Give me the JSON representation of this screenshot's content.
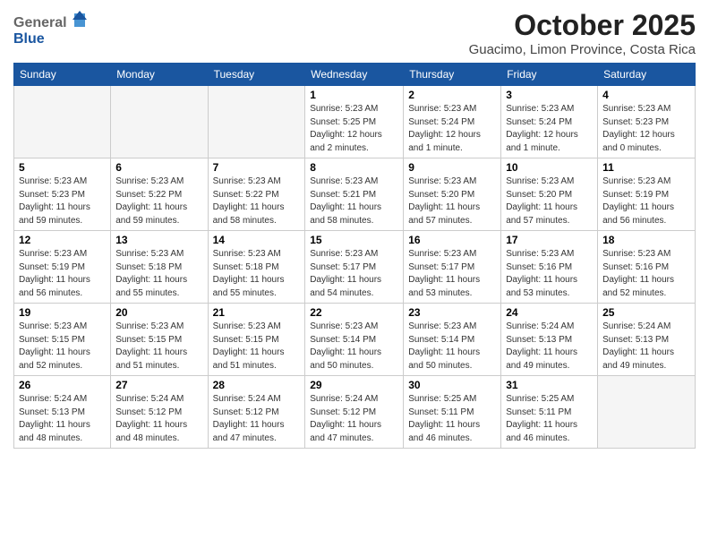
{
  "header": {
    "logo_general": "General",
    "logo_blue": "Blue",
    "month_title": "October 2025",
    "location": "Guacimo, Limon Province, Costa Rica"
  },
  "weekdays": [
    "Sunday",
    "Monday",
    "Tuesday",
    "Wednesday",
    "Thursday",
    "Friday",
    "Saturday"
  ],
  "weeks": [
    [
      {
        "day": "",
        "info": ""
      },
      {
        "day": "",
        "info": ""
      },
      {
        "day": "",
        "info": ""
      },
      {
        "day": "1",
        "info": "Sunrise: 5:23 AM\nSunset: 5:25 PM\nDaylight: 12 hours\nand 2 minutes."
      },
      {
        "day": "2",
        "info": "Sunrise: 5:23 AM\nSunset: 5:24 PM\nDaylight: 12 hours\nand 1 minute."
      },
      {
        "day": "3",
        "info": "Sunrise: 5:23 AM\nSunset: 5:24 PM\nDaylight: 12 hours\nand 1 minute."
      },
      {
        "day": "4",
        "info": "Sunrise: 5:23 AM\nSunset: 5:23 PM\nDaylight: 12 hours\nand 0 minutes."
      }
    ],
    [
      {
        "day": "5",
        "info": "Sunrise: 5:23 AM\nSunset: 5:23 PM\nDaylight: 11 hours\nand 59 minutes."
      },
      {
        "day": "6",
        "info": "Sunrise: 5:23 AM\nSunset: 5:22 PM\nDaylight: 11 hours\nand 59 minutes."
      },
      {
        "day": "7",
        "info": "Sunrise: 5:23 AM\nSunset: 5:22 PM\nDaylight: 11 hours\nand 58 minutes."
      },
      {
        "day": "8",
        "info": "Sunrise: 5:23 AM\nSunset: 5:21 PM\nDaylight: 11 hours\nand 58 minutes."
      },
      {
        "day": "9",
        "info": "Sunrise: 5:23 AM\nSunset: 5:20 PM\nDaylight: 11 hours\nand 57 minutes."
      },
      {
        "day": "10",
        "info": "Sunrise: 5:23 AM\nSunset: 5:20 PM\nDaylight: 11 hours\nand 57 minutes."
      },
      {
        "day": "11",
        "info": "Sunrise: 5:23 AM\nSunset: 5:19 PM\nDaylight: 11 hours\nand 56 minutes."
      }
    ],
    [
      {
        "day": "12",
        "info": "Sunrise: 5:23 AM\nSunset: 5:19 PM\nDaylight: 11 hours\nand 56 minutes."
      },
      {
        "day": "13",
        "info": "Sunrise: 5:23 AM\nSunset: 5:18 PM\nDaylight: 11 hours\nand 55 minutes."
      },
      {
        "day": "14",
        "info": "Sunrise: 5:23 AM\nSunset: 5:18 PM\nDaylight: 11 hours\nand 55 minutes."
      },
      {
        "day": "15",
        "info": "Sunrise: 5:23 AM\nSunset: 5:17 PM\nDaylight: 11 hours\nand 54 minutes."
      },
      {
        "day": "16",
        "info": "Sunrise: 5:23 AM\nSunset: 5:17 PM\nDaylight: 11 hours\nand 53 minutes."
      },
      {
        "day": "17",
        "info": "Sunrise: 5:23 AM\nSunset: 5:16 PM\nDaylight: 11 hours\nand 53 minutes."
      },
      {
        "day": "18",
        "info": "Sunrise: 5:23 AM\nSunset: 5:16 PM\nDaylight: 11 hours\nand 52 minutes."
      }
    ],
    [
      {
        "day": "19",
        "info": "Sunrise: 5:23 AM\nSunset: 5:15 PM\nDaylight: 11 hours\nand 52 minutes."
      },
      {
        "day": "20",
        "info": "Sunrise: 5:23 AM\nSunset: 5:15 PM\nDaylight: 11 hours\nand 51 minutes."
      },
      {
        "day": "21",
        "info": "Sunrise: 5:23 AM\nSunset: 5:15 PM\nDaylight: 11 hours\nand 51 minutes."
      },
      {
        "day": "22",
        "info": "Sunrise: 5:23 AM\nSunset: 5:14 PM\nDaylight: 11 hours\nand 50 minutes."
      },
      {
        "day": "23",
        "info": "Sunrise: 5:23 AM\nSunset: 5:14 PM\nDaylight: 11 hours\nand 50 minutes."
      },
      {
        "day": "24",
        "info": "Sunrise: 5:24 AM\nSunset: 5:13 PM\nDaylight: 11 hours\nand 49 minutes."
      },
      {
        "day": "25",
        "info": "Sunrise: 5:24 AM\nSunset: 5:13 PM\nDaylight: 11 hours\nand 49 minutes."
      }
    ],
    [
      {
        "day": "26",
        "info": "Sunrise: 5:24 AM\nSunset: 5:13 PM\nDaylight: 11 hours\nand 48 minutes."
      },
      {
        "day": "27",
        "info": "Sunrise: 5:24 AM\nSunset: 5:12 PM\nDaylight: 11 hours\nand 48 minutes."
      },
      {
        "day": "28",
        "info": "Sunrise: 5:24 AM\nSunset: 5:12 PM\nDaylight: 11 hours\nand 47 minutes."
      },
      {
        "day": "29",
        "info": "Sunrise: 5:24 AM\nSunset: 5:12 PM\nDaylight: 11 hours\nand 47 minutes."
      },
      {
        "day": "30",
        "info": "Sunrise: 5:25 AM\nSunset: 5:11 PM\nDaylight: 11 hours\nand 46 minutes."
      },
      {
        "day": "31",
        "info": "Sunrise: 5:25 AM\nSunset: 5:11 PM\nDaylight: 11 hours\nand 46 minutes."
      },
      {
        "day": "",
        "info": ""
      }
    ]
  ]
}
